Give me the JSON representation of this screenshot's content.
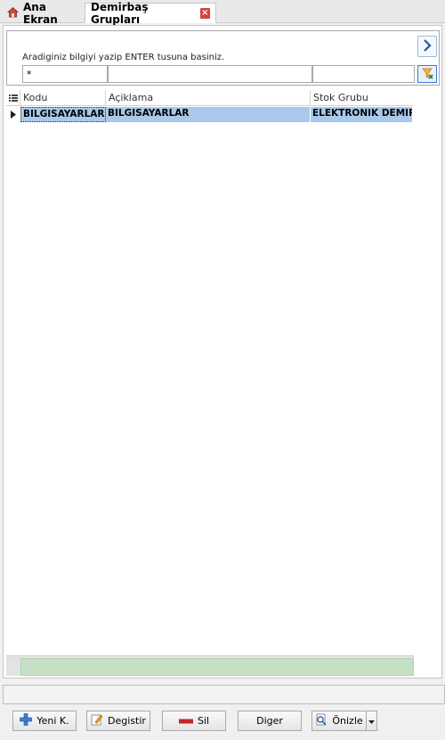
{
  "tabs": [
    {
      "label": "Ana Ekran"
    },
    {
      "label": "Demirbaş Grupları"
    }
  ],
  "search": {
    "hint": "Aradiginiz bilgiyi yazip ENTER tusuna basiniz.",
    "filters": [
      "*",
      "",
      ""
    ]
  },
  "grid": {
    "columns": [
      "Kodu",
      "Açiklama",
      "Stok Grubu"
    ],
    "rows": [
      {
        "kodu": "BILGISAYARLAR",
        "aciklama": "BILGISAYARLAR",
        "stok_grubu": "ELEKTRONIK DEMIR"
      }
    ]
  },
  "buttons": {
    "yeni": "Yeni K.",
    "degistir": "Degistir",
    "sil": "Sil",
    "diger": "Diger",
    "onizle": "Önizle"
  },
  "colors": {
    "selection": "#a8c8ec",
    "footer_green": "#c6e0c6",
    "close_red": "#d8413d"
  }
}
